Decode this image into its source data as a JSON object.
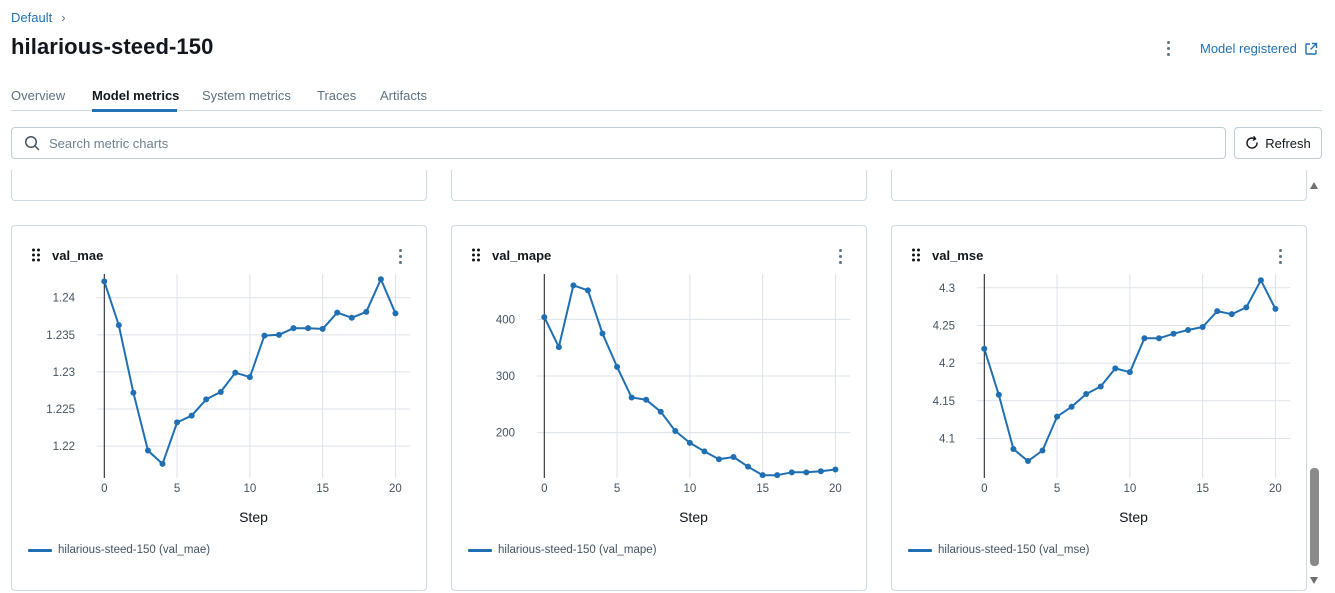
{
  "breadcrumb": {
    "parent": "Default",
    "separator": "›"
  },
  "header": {
    "title": "hilarious-steed-150",
    "model_registered": "Model registered"
  },
  "tabs": [
    {
      "label": "Overview",
      "active": false
    },
    {
      "label": "Model metrics",
      "active": true
    },
    {
      "label": "System metrics",
      "active": false
    },
    {
      "label": "Traces",
      "active": false
    },
    {
      "label": "Artifacts",
      "active": false
    }
  ],
  "search": {
    "placeholder": "Search metric charts",
    "value": ""
  },
  "refresh_label": "Refresh",
  "colors": {
    "accent": "#2272b4",
    "series": "#1f6fb2",
    "grid": "#dde3ea"
  },
  "icons": [
    "chevron-right-icon",
    "kebab-menu-icon",
    "external-link-icon",
    "search-icon",
    "refresh-icon",
    "drag-handle-icon",
    "scroll-up-icon",
    "scroll-down-icon"
  ],
  "chart_data": [
    {
      "type": "line",
      "title": "val_mae",
      "xlabel": "Step",
      "ylabel": "",
      "xticks": [
        0,
        5,
        10,
        15,
        20
      ],
      "yticks": [
        "1.22",
        "1.225",
        "1.23",
        "1.235",
        "1.24"
      ],
      "xlim": [
        -0.5,
        21
      ],
      "ylim": [
        1.2157,
        1.2432
      ],
      "grid": true,
      "legend": "bottom-left",
      "series": [
        {
          "name": "hilarious-steed-150 (val_mae)",
          "x": [
            0,
            1,
            2,
            3,
            4,
            5,
            6,
            7,
            8,
            9,
            10,
            11,
            12,
            13,
            14,
            15,
            16,
            17,
            18,
            19,
            20
          ],
          "y": [
            1.2422,
            1.2363,
            1.2272,
            1.2194,
            1.2176,
            1.2232,
            1.2241,
            1.2263,
            1.2273,
            1.2299,
            1.2293,
            1.2349,
            1.235,
            1.2359,
            1.2359,
            1.2358,
            1.238,
            1.2373,
            1.2381,
            1.2425,
            1.2379
          ]
        }
      ]
    },
    {
      "type": "line",
      "title": "val_mape",
      "xlabel": "Step",
      "ylabel": "",
      "xticks": [
        0,
        5,
        10,
        15,
        20
      ],
      "yticks": [
        "200",
        "300",
        "400"
      ],
      "xlim": [
        -0.5,
        21
      ],
      "ylim": [
        120,
        480
      ],
      "grid": true,
      "legend": "bottom-left",
      "series": [
        {
          "name": "hilarious-steed-150 (val_mape)",
          "x": [
            0,
            1,
            2,
            3,
            4,
            5,
            6,
            7,
            8,
            9,
            10,
            11,
            12,
            13,
            14,
            15,
            16,
            17,
            18,
            19,
            20
          ],
          "y": [
            404,
            351,
            460,
            451,
            375,
            316,
            262,
            258,
            237,
            203,
            182,
            167,
            153,
            157,
            140,
            125,
            125,
            130,
            130,
            132,
            135
          ]
        }
      ]
    },
    {
      "type": "line",
      "title": "val_mse",
      "xlabel": "Step",
      "ylabel": "",
      "xticks": [
        0,
        5,
        10,
        15,
        20
      ],
      "yticks": [
        "4.1",
        "4.15",
        "4.2",
        "4.25",
        "4.3"
      ],
      "xlim": [
        -0.5,
        21
      ],
      "ylim": [
        4.0475,
        4.3183
      ],
      "grid": true,
      "legend": "bottom-left",
      "series": [
        {
          "name": "hilarious-steed-150 (val_mse)",
          "x": [
            0,
            1,
            2,
            3,
            4,
            5,
            6,
            7,
            8,
            9,
            10,
            11,
            12,
            13,
            14,
            15,
            16,
            17,
            18,
            19,
            20
          ],
          "y": [
            4.219,
            4.158,
            4.086,
            4.07,
            4.084,
            4.129,
            4.142,
            4.159,
            4.169,
            4.193,
            4.188,
            4.233,
            4.233,
            4.239,
            4.244,
            4.248,
            4.269,
            4.265,
            4.274,
            4.31,
            4.272
          ]
        }
      ]
    }
  ]
}
